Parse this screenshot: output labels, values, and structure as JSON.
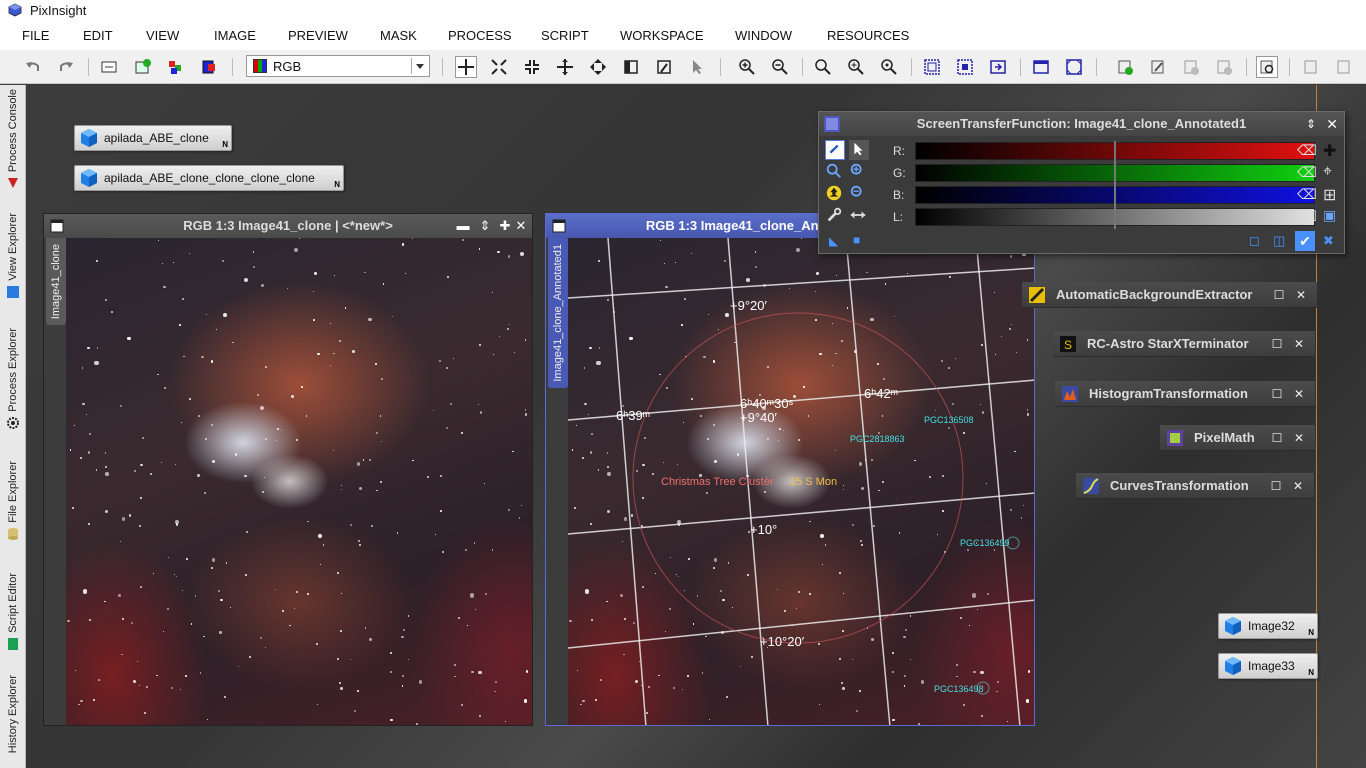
{
  "app": {
    "title": "PixInsight"
  },
  "menu": [
    "FILE",
    "EDIT",
    "VIEW",
    "IMAGE",
    "PREVIEW",
    "MASK",
    "PROCESS",
    "SCRIPT",
    "WORKSPACE",
    "WINDOW",
    "RESOURCES"
  ],
  "toolbar": {
    "channel_select": "RGB"
  },
  "sidebar": {
    "tabs": [
      "Process Console",
      "View Explorer",
      "Process Explorer",
      "File Explorer",
      "Script Editor",
      "History Explorer"
    ]
  },
  "desktop_icons": {
    "icon1": "apilada_ABE_clone",
    "icon2": "apilada_ABE_clone_clone_clone_clone",
    "icon3": "Image32",
    "icon4": "Image33",
    "corner_mark": "N"
  },
  "windows": {
    "left": {
      "title": "RGB 1:3 Image41_clone | <*new*>",
      "tab": "Image41_clone"
    },
    "right": {
      "title": "RGB 1:3 Image41_clone_Annotated1 | <*new*>",
      "tab": "Image41_clone_Annotated1"
    }
  },
  "annotations": {
    "dec1": "+9°20′",
    "dec2": "+9°40′",
    "dec3": "+10°",
    "dec4": "+10°20′",
    "ra1": "6ʰ39ᵐ",
    "ra2": "6ʰ40ᵐ30ˢ",
    "ra3": "6ʰ42ᵐ",
    "obj1": "Christmas Tree Cluster",
    "obj2": "15 S Mon",
    "pgc1": "PGC136508",
    "pgc2": "PGC2818863",
    "pgc3": "PGC136499",
    "pgc4": "PGC136498"
  },
  "stf": {
    "title": "ScreenTransferFunction: Image41_clone_Annotated1",
    "labels": [
      "R:",
      "G:",
      "B:",
      "L:"
    ]
  },
  "processes": [
    "AutomaticBackgroundExtractor",
    "RC-Astro StarXTerminator",
    "HistogramTransformation",
    "PixelMath",
    "CurvesTransformation"
  ],
  "colors": {
    "active_title": "#4a5ab4",
    "stf_red": "#e01010",
    "stf_green": "#10d010",
    "stf_blue": "#1010e0"
  }
}
